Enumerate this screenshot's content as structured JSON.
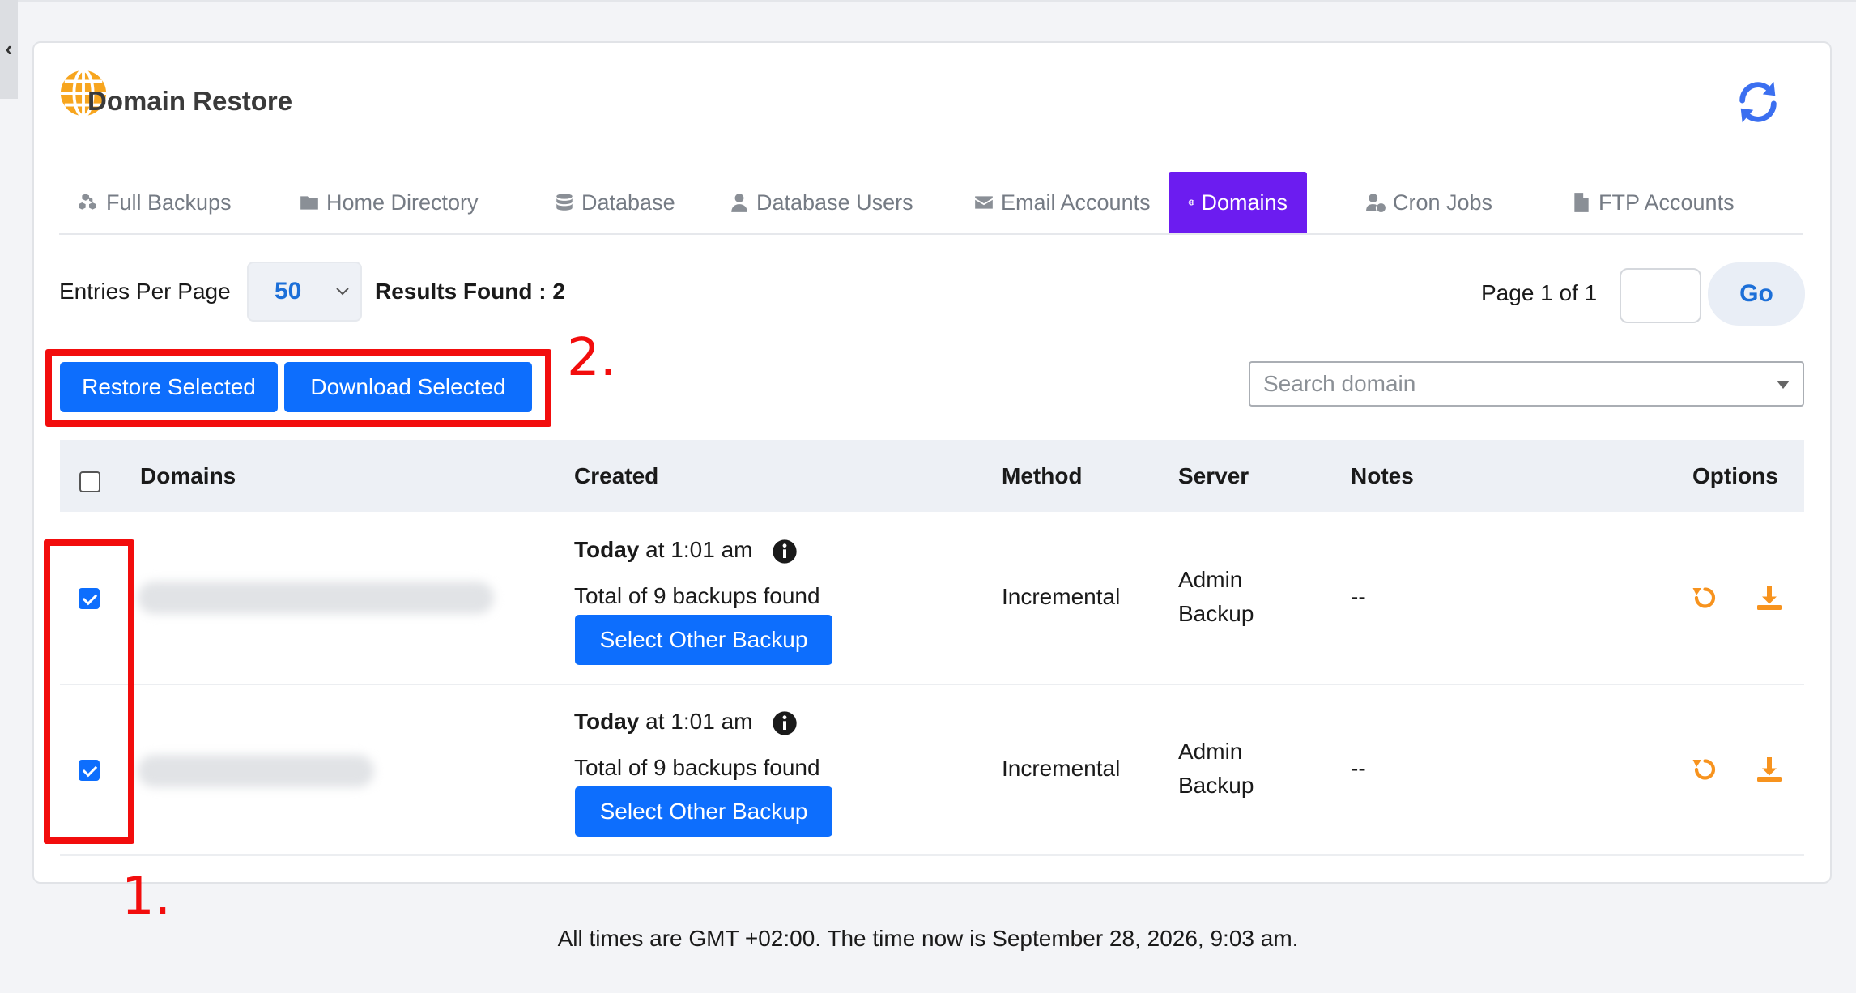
{
  "app": {
    "title": "Domain Restore",
    "accent_color": "#6c1cf0",
    "button_color": "#0d6efd",
    "icon_color": "#f7931e"
  },
  "sidebar_toggle": {
    "glyph": "‹"
  },
  "tabs": [
    {
      "label": "Full Backups",
      "icon": "cubes-icon",
      "active": false
    },
    {
      "label": "Home Directory",
      "icon": "folder-icon",
      "active": false
    },
    {
      "label": "Database",
      "icon": "database-icon",
      "active": false
    },
    {
      "label": "Database Users",
      "icon": "user-icon",
      "active": false
    },
    {
      "label": "Email Accounts",
      "icon": "envelope-icon",
      "active": false
    },
    {
      "label": "Domains",
      "icon": "globe-icon",
      "active": true
    },
    {
      "label": "Cron Jobs",
      "icon": "user-clock-icon",
      "active": false
    },
    {
      "label": "FTP Accounts",
      "icon": "file-icon",
      "active": false
    }
  ],
  "toolbar": {
    "entries_label": "Entries Per Page",
    "entries_value": "50",
    "results_text": "Results Found : 2",
    "page_text": "Page 1 of 1",
    "go_label": "Go",
    "restore_selected_label": "Restore Selected",
    "download_selected_label": "Download Selected",
    "search_placeholder": "Search domain"
  },
  "annotations": {
    "one": "1.",
    "two": "2."
  },
  "table": {
    "headers": {
      "domains": "Domains",
      "created": "Created",
      "method": "Method",
      "server": "Server",
      "notes": "Notes",
      "options": "Options"
    },
    "rows": [
      {
        "checked": true,
        "created_day": "Today",
        "created_time": " at 1:01 am",
        "backups_text": "Total of 9 backups found",
        "select_other_label": "Select Other Backup",
        "method": "Incremental",
        "server_line1": "Admin",
        "server_line2": "Backup",
        "notes": "--"
      },
      {
        "checked": true,
        "created_day": "Today",
        "created_time": " at 1:01 am",
        "backups_text": "Total of 9 backups found",
        "select_other_label": "Select Other Backup",
        "method": "Incremental",
        "server_line1": "Admin",
        "server_line2": "Backup",
        "notes": "--"
      }
    ]
  },
  "footer": {
    "time_note": "All times are GMT +02:00. The time now is September 28, 2026, 9:03 am."
  }
}
